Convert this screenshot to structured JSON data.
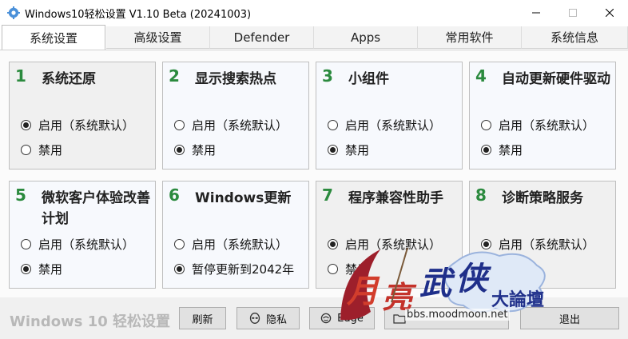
{
  "window": {
    "title": "Windows10轻松设置 V1.10 Beta (20241003)"
  },
  "tabs": [
    {
      "label": "系统设置",
      "active": true
    },
    {
      "label": "高级设置",
      "active": false
    },
    {
      "label": "Defender",
      "active": false
    },
    {
      "label": "Apps",
      "active": false
    },
    {
      "label": "常用软件",
      "active": false
    },
    {
      "label": "系统信息",
      "active": false
    }
  ],
  "cards": [
    {
      "num": "1",
      "title": "系统还原",
      "options": [
        "启用（系统默认）",
        "禁用"
      ],
      "selected": 0
    },
    {
      "num": "2",
      "title": "显示搜索热点",
      "options": [
        "启用（系统默认）",
        "禁用"
      ],
      "selected": 1
    },
    {
      "num": "3",
      "title": "小组件",
      "options": [
        "启用（系统默认）",
        "禁用"
      ],
      "selected": 1
    },
    {
      "num": "4",
      "title": "自动更新硬件驱动",
      "options": [
        "启用（系统默认）",
        "禁用"
      ],
      "selected": 1
    },
    {
      "num": "5",
      "title": "微软客户体验改善计划",
      "options": [
        "启用（系统默认）",
        "禁用"
      ],
      "selected": 1
    },
    {
      "num": "6",
      "title": "Windows更新",
      "options": [
        "启用（系统默认）",
        "暂停更新到2042年"
      ],
      "selected": 1
    },
    {
      "num": "7",
      "title": "程序兼容性助手",
      "options": [
        "启用（系统默认）",
        "禁用"
      ],
      "selected": 0
    },
    {
      "num": "8",
      "title": "诊断策略服务",
      "options": [
        "启用（系统默认）",
        "禁用"
      ],
      "selected": 0
    }
  ],
  "bottom": {
    "brand": "Windows 10 轻松设置",
    "buttons": {
      "refresh": "刷新",
      "privacy": "隐私",
      "edge": "Edge",
      "folder": "",
      "exit": "退出"
    }
  },
  "watermark": {
    "text": "月亮武侠大論壇",
    "url": "bbs.moodmoon.net"
  },
  "colors": {
    "number": "#2b8a3e",
    "card_default_bg": "#f0f0f0",
    "card_bg": "#f7f9fd",
    "brand": "#b8b8b8"
  }
}
